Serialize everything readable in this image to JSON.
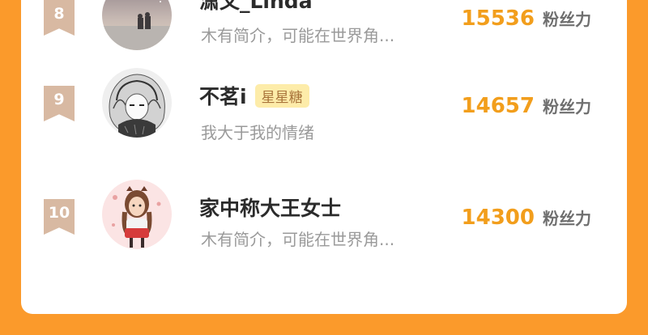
{
  "rows": [
    {
      "rank": "8",
      "name": "潇文_Linda",
      "badge": "",
      "description": "木有简介，可能在世界角...",
      "fans": "15536",
      "fans_label": "粉丝力"
    },
    {
      "rank": "9",
      "name": "不茗i",
      "badge": "星星糖",
      "description": "我大于我的情绪",
      "fans": "14657",
      "fans_label": "粉丝力"
    },
    {
      "rank": "10",
      "name": "家中称大王女士",
      "badge": "",
      "description": "木有简介，可能在世界角...",
      "fans": "14300",
      "fans_label": "粉丝力"
    }
  ],
  "colors": {
    "background": "#fb9a2b",
    "rank_badge": "#d8b9a2",
    "fans_count": "#f29e1c",
    "badge_bg": "#fdeca9"
  }
}
